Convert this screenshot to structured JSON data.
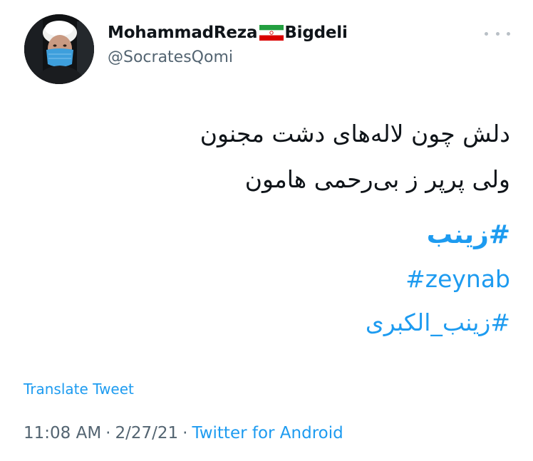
{
  "author": {
    "name_part1": "MohammadReza",
    "name_part2": "Bigdeli",
    "flag_icon": "iran-flag-icon",
    "handle": "@SocratesQomi",
    "avatar_icon": "profile-photo-avatar"
  },
  "more_icon": "more-horizontal-icon",
  "tweet": {
    "lines": [
      "دلش چون لاله‌های دشت مجنون",
      "ولی پرپر ز بی‌رحمی هامون"
    ],
    "hashtags": [
      "#زينب",
      "#zeynab",
      "#زينب_الكبرى"
    ]
  },
  "translate_label": "Translate Tweet",
  "meta": {
    "time": "11:08 AM",
    "separator_1": "·",
    "date": "2/27/21",
    "separator_2": "·",
    "source": "Twitter for Android"
  },
  "colors": {
    "link_blue": "#1d9bf0",
    "secondary_gray": "#536471",
    "text_black": "#0f1419"
  }
}
